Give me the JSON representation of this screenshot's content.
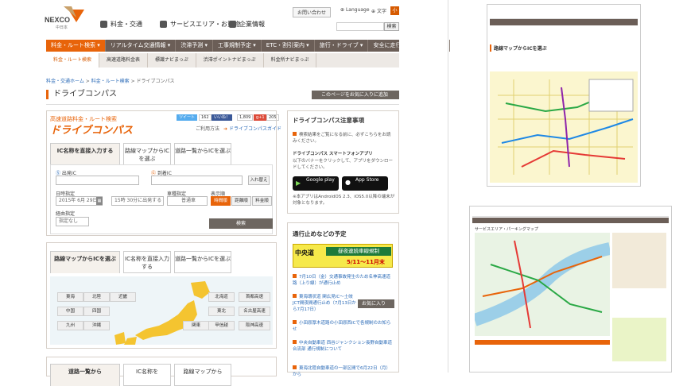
{
  "brand": {
    "name": "NEXCO",
    "sub": "中日本"
  },
  "topnav": [
    {
      "label": "料金・交通"
    },
    {
      "label": "サービスエリア・お買物"
    },
    {
      "label": "企業情報"
    }
  ],
  "util": {
    "notice": "お問い合わせ",
    "language": "Language",
    "text_size": "文字",
    "size_btn": "小",
    "search_btn": "検索"
  },
  "mainnav": [
    "料金・ルート検索 ▾",
    "リアルタイム交通情報 ▾",
    "渋滞予測 ▾",
    "工事規制予定 ▾",
    "ETC・割引案内 ▾",
    "旅行・ドライブ ▾",
    "安全に走行いただくために ▾"
  ],
  "subnav": [
    "料金・ルート検索",
    "高速道路料金表",
    "標識ナビまっぷ",
    "渋滞ポイントナビまっぷ",
    "料金所ナビまっぷ"
  ],
  "breadcrumb": [
    "料金・交通ホーム",
    "料金・ルート検索",
    "ドライブコンパス"
  ],
  "page_title": "ドライブコンパス",
  "fav_button": "このページをお気に入りに追加",
  "tool": {
    "brand_small": "高速道路料金・ルート検索",
    "brand_big": "ドライブコンパス",
    "tweet": "ツイート",
    "tweet_count": "162",
    "like": "いいね！",
    "like_count": "1,809",
    "gplus": "g+1",
    "gplus_count": "205",
    "usage": "ご利用方法",
    "guide": "ドライブコンパスガイド"
  },
  "tabs1": [
    {
      "label": "IC名称を直接入力する"
    },
    {
      "label": "路線マップからICを選ぶ"
    },
    {
      "label": "道路一覧からICを選ぶ"
    }
  ],
  "form": {
    "from_label": "出発IC",
    "to_label": "到着IC",
    "via_button": "入れ替え",
    "date_label": "日時指定",
    "date_value": "2015年 6月 29日",
    "time_value": "15時 30分に出発する",
    "car_label": "車種指定",
    "car_value": "普通車",
    "display_label": "表示順",
    "sort_options": [
      "時間順",
      "距離順",
      "料金順"
    ],
    "via_label": "経由指定",
    "via_value": "指定なし",
    "search": "検索"
  },
  "tabs2": [
    {
      "label": "路線マップからICを選ぶ"
    },
    {
      "label": "IC名称を直接入力する"
    },
    {
      "label": "道路一覧からICを選ぶ"
    }
  ],
  "regions_left": [
    "東海",
    "北陸",
    "近畿",
    "中国",
    "四国",
    "九州",
    "沖縄"
  ],
  "regions_right": [
    "北海道",
    "首都高速",
    "東北",
    "名古屋高速",
    "関東",
    "甲信越",
    "阪神高速"
  ],
  "tabs3": [
    {
      "label": "道路一覧から"
    },
    {
      "label": "IC名称を"
    },
    {
      "label": "路線マップから"
    }
  ],
  "notes": {
    "title": "ドライブコンパス注意事項",
    "text1": "検索結果をご覧になる前に、必ずこちらをお読みください。",
    "app_title": "ドライブコンパス スマートフォンアプリ",
    "app_text": "以下のバナーをクリックして、アプリをダウンロードしてください。",
    "google": "Google play",
    "apple": "App Store",
    "note": "※本アプリはAndroidOS 2.3、iOS5.0以降の端末が対象となります。"
  },
  "closure": {
    "title": "通行止めなどの予定",
    "banner_road": "中央道",
    "banner_main": "昼夜連続車線規制",
    "banner_date": "5/11～11月末",
    "fav_popup": "お気に入り",
    "items": [
      "7月10日（金）交通事故発生のため名神高速道路（上り線）が通行止め",
      "東海環状道 関広見IC～土岐JCT間夜間通行止め（7月13日から7月17日）",
      "小田原厚木道路の小田原西ICで各規制のお知らせ",
      "中央自動車道 西谷ジャンクション長野自動車道合流部 通行規制について",
      "東海北陸自動車道の一部区間で6月22日（月）から"
    ]
  },
  "thumb1": {
    "title": "路線マップからICを選ぶ"
  },
  "thumb2": {
    "title": "サービスエリア・パーキングマップ"
  },
  "colors": {
    "accent": "#e8640a",
    "nav": "#6b5e57",
    "link": "#2a6ab7"
  }
}
